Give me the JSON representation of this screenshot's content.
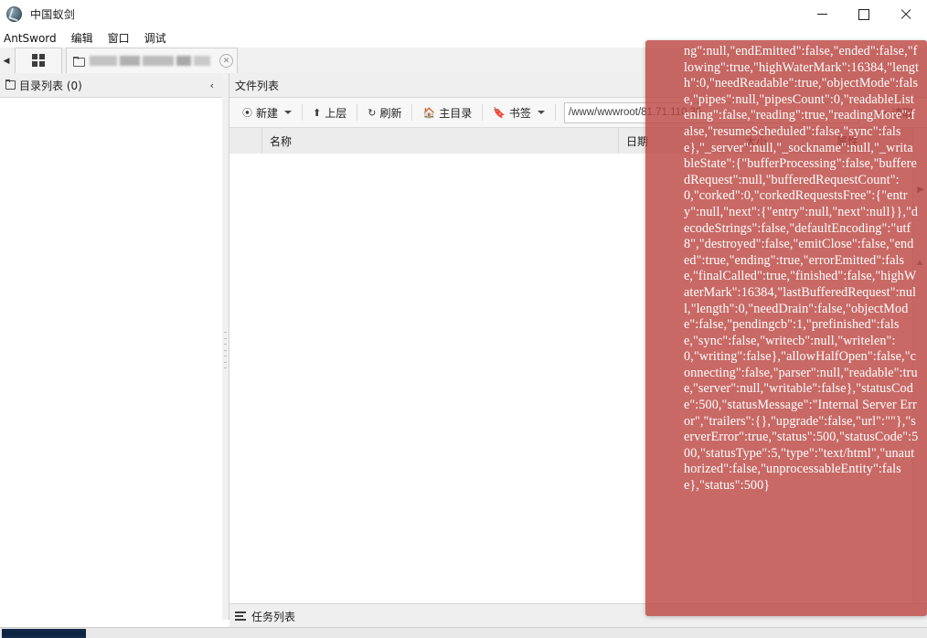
{
  "window": {
    "title": "中国蚁剑",
    "icon": "antsword-logo-icon",
    "controls": {
      "minimize": "—",
      "maximize": "□",
      "close": "✕"
    }
  },
  "menubar": {
    "items": [
      {
        "label": "AntSword",
        "name": "menu-antsword"
      },
      {
        "label": "编辑",
        "name": "menu-edit"
      },
      {
        "label": "窗口",
        "name": "menu-window"
      },
      {
        "label": "调试",
        "name": "menu-debug"
      }
    ]
  },
  "tabstrip": {
    "scroll_left": "◀",
    "home_tab_icon": "grid-icon",
    "document_tab": {
      "icon": "folder-icon",
      "label": "",
      "close": "✕"
    }
  },
  "left_panel": {
    "title": "目录列表 (0)",
    "icon": "folder-icon",
    "collapse": "‹"
  },
  "file_list": {
    "title": "文件列表",
    "icon": "file-icon",
    "toolbar": {
      "new": {
        "label": "新建",
        "icon": "plus-circle-icon",
        "caret": true
      },
      "up": {
        "label": "上层",
        "icon": "arrow-up-icon"
      },
      "refresh": {
        "label": "刷新",
        "icon": "refresh-icon"
      },
      "home": {
        "label": "主目录",
        "icon": "home-icon"
      },
      "bookmark": {
        "label": "书签",
        "icon": "bookmark-icon",
        "caret": true
      },
      "path_value": "/www/wwwroot/81.71.110.36",
      "path_placeholder": "/www/wwwroot/",
      "read": {
        "label": "读取",
        "icon": "arrow-right-icon"
      }
    },
    "columns": [
      {
        "label": "",
        "name": "column-checkbox"
      },
      {
        "label": "名称",
        "name": "column-name"
      },
      {
        "label": "日期",
        "name": "column-date"
      },
      {
        "label": "大小",
        "name": "column-size"
      },
      {
        "label": "属性",
        "name": "column-attributes"
      }
    ],
    "rows": []
  },
  "task_list": {
    "title": "任务列表",
    "icon": "list-icon"
  },
  "error_overlay": {
    "message": "ng\":null,\"endEmitted\":false,\"ended\":false,\"flowing\":true,\"highWaterMark\":16384,\"length\":0,\"needReadable\":true,\"objectMode\":false,\"pipes\":null,\"pipesCount\":0,\"readableListening\":false,\"reading\":true,\"readingMore\":false,\"resumeScheduled\":false,\"sync\":false},\"_server\":null,\"_sockname\":null,\"_writableState\":{\"bufferProcessing\":false,\"bufferedRequest\":null,\"bufferedRequestCount\":0,\"corked\":0,\"corkedRequestsFree\":{\"entry\":null,\"next\":{\"entry\":null,\"next\":null}},\"decodeStrings\":false,\"defaultEncoding\":\"utf8\",\"destroyed\":false,\"emitClose\":false,\"ended\":true,\"ending\":true,\"errorEmitted\":false,\"finalCalled\":true,\"finished\":false,\"highWaterMark\":16384,\"lastBufferedRequest\":null,\"length\":0,\"needDrain\":false,\"objectMode\":false,\"pendingcb\":1,\"prefinished\":false,\"sync\":false,\"writecb\":null,\"writelen\":0,\"writing\":false},\"allowHalfOpen\":false,\"connecting\":false,\"parser\":null,\"readable\":true,\"server\":null,\"writable\":false},\"statusCode\":500,\"statusMessage\":\"Internal Server Error\",\"trailers\":{},\"upgrade\":false,\"url\":\"\"},\"serverError\":true,\"status\":500,\"statusCode\":500,\"statusType\":5,\"type\":\"text/html\",\"unauthorized\":false,\"unprocessableEntity\":false},\"status\":500}",
    "color": "#ba443e"
  },
  "colors": {
    "error_red": "#ba443e",
    "chrome_gray": "#f0f0f0",
    "border_gray": "#d3d3d3",
    "progress_blue": "#0d2140"
  }
}
